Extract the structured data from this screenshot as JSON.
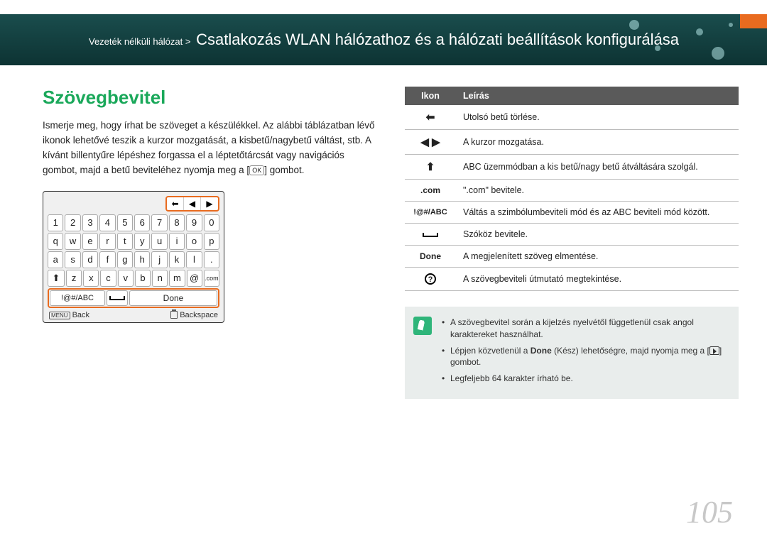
{
  "header": {
    "breadcrumb": "Vezeték nélküli hálózat >",
    "title": "Csatlakozás WLAN hálózathoz és a hálózati beállítások konfigurálása"
  },
  "section_title": "Szövegbevitel",
  "intro_pre": "Ismerje meg, hogy írhat be szöveget a készülékkel. Az alábbi táblázatban lévő ikonok lehetővé teszik a kurzor mozgatását, a kisbetű/nagybetű váltást, stb. A kívánt billentyűre lépéshez forgassa el a léptetőtárcsát vagy navigációs gombot, majd a betű beviteléhez nyomja meg a ",
  "intro_ok": "OK",
  "intro_post": " gombot.",
  "keyboard": {
    "row_num": [
      "1",
      "2",
      "3",
      "4",
      "5",
      "6",
      "7",
      "8",
      "9",
      "0"
    ],
    "row_q": [
      "q",
      "w",
      "e",
      "r",
      "t",
      "y",
      "u",
      "i",
      "o",
      "p"
    ],
    "row_a": [
      "a",
      "s",
      "d",
      "f",
      "g",
      "h",
      "j",
      "k",
      "l",
      "."
    ],
    "row_z": [
      "z",
      "x",
      "c",
      "v",
      "b",
      "n",
      "m",
      "@",
      ".com"
    ],
    "mode": "!@#/ABC",
    "done": "Done",
    "back": "Back",
    "backspace": "Backspace",
    "menu": "MENU"
  },
  "table": {
    "h1": "Ikon",
    "h2": "Leírás",
    "rows": [
      {
        "icon_label": "back-arrow",
        "desc": "Utolsó betű törlése."
      },
      {
        "icon_label": "cursor-arrows",
        "desc": "A kurzor mozgatása."
      },
      {
        "icon_label": "shift-arrow",
        "desc": "ABC üzemmódban a kis betű/nagy betű átváltására szolgál."
      },
      {
        "icon_label": ".com",
        "desc": "\".com\" bevitele."
      },
      {
        "icon_label": "!@#/ABC",
        "desc": "Váltás a szimbólumbeviteli mód és az ABC beviteli mód között."
      },
      {
        "icon_label": "spacebar",
        "desc": "Szóköz bevitele."
      },
      {
        "icon_label": "Done",
        "desc": "A megjelenített szöveg elmentése."
      },
      {
        "icon_label": "help",
        "desc": "A szövegbeviteli útmutató megtekintése."
      }
    ]
  },
  "note": {
    "li1": "A szövegbevitel során a kijelzés nyelvétől függetlenül csak angol karaktereket használhat.",
    "li2_pre": "Lépjen közvetlenül a ",
    "li2_bold": "Done",
    "li2_mid": " (Kész) lehetőségre, majd nyomja meg a [",
    "li2_post": "] gombot.",
    "li3": "Legfeljebb 64 karakter írható be."
  },
  "page_number": "105"
}
